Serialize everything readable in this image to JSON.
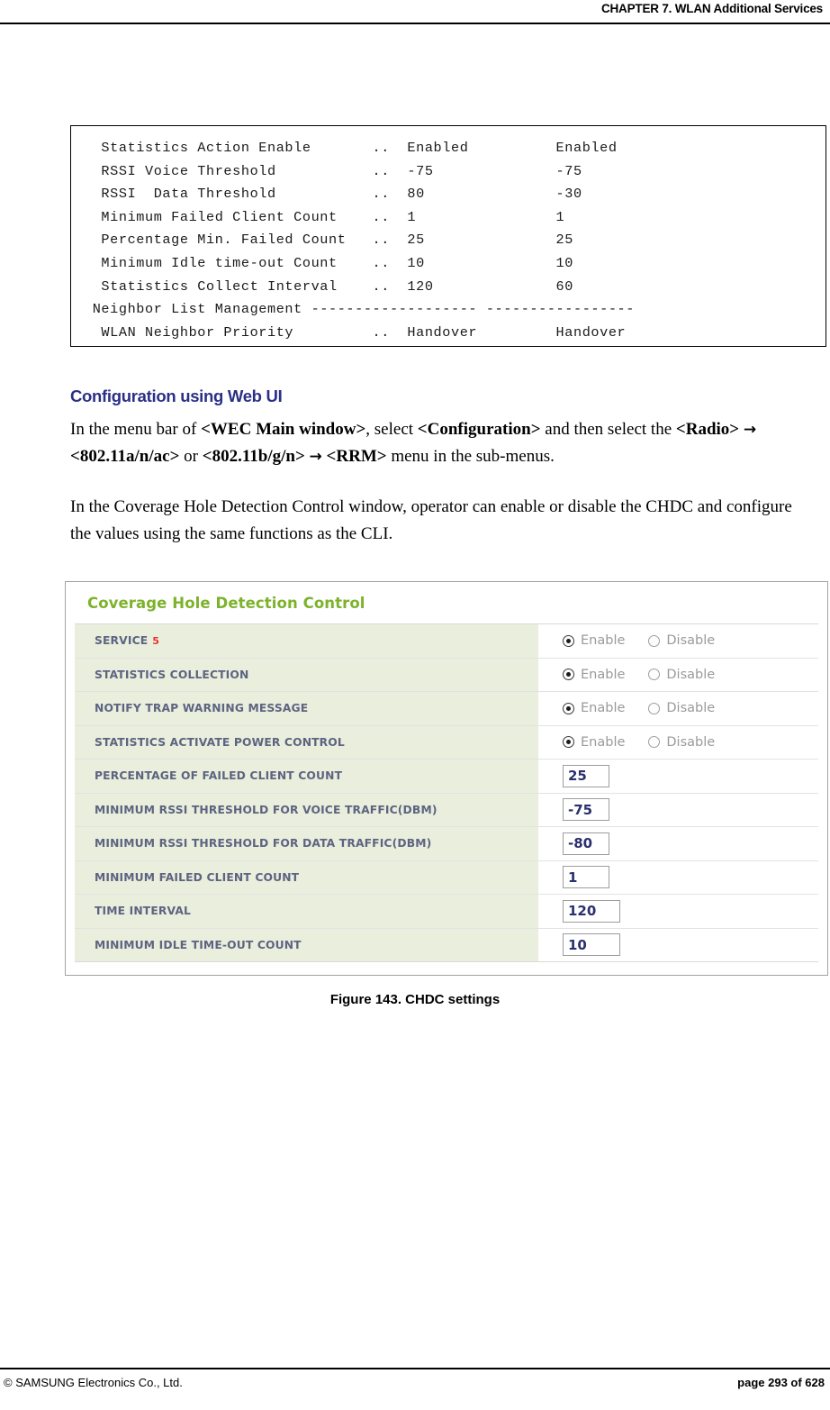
{
  "header": {
    "chapter_title": "CHAPTER 7. WLAN Additional Services"
  },
  "cli_output": {
    "lines": [
      "  Statistics Action Enable       ..  Enabled          Enabled",
      "  RSSI Voice Threshold           ..  -75              -75",
      "  RSSI  Data Threshold           ..  80               -30",
      "  Minimum Failed Client Count    ..  1                1",
      "  Percentage Min. Failed Count   ..  25               25",
      "  Minimum Idle time-out Count    ..  10               10",
      "  Statistics Collect Interval    ..  120              60",
      " Neighbor List Management ------------------- -----------------",
      "  WLAN Neighbor Priority         ..  Handover         Handover"
    ]
  },
  "section": {
    "heading": "Configuration using Web UI",
    "menu_paragraph": {
      "t1": "In the menu bar of ",
      "b1": "<WEC Main window>",
      "t2": ", select ",
      "b2": "<Configuration>",
      "t3": " and then select the ",
      "b3": "<Radio>",
      "arrow1": "→",
      "b4": "<802.11a/n/ac>",
      "t4": " or ",
      "b5": "<802.11b/g/n>",
      "arrow2": "→",
      "b6": "<RRM>",
      "t5": " menu in the sub-menus."
    },
    "chdc_paragraph": "In the Coverage Hole Detection Control window, operator can enable or disable the CHDC and configure the values using the same functions as the CLI."
  },
  "ui_panel": {
    "title": "Coverage Hole Detection Control",
    "radio_labels": {
      "enable": "Enable",
      "disable": "Disable"
    },
    "rows": [
      {
        "label": "SERVICE",
        "note": "5",
        "type": "radio",
        "selected": "enable"
      },
      {
        "label": "STATISTICS COLLECTION",
        "note": "",
        "type": "radio",
        "selected": "enable"
      },
      {
        "label": "NOTIFY TRAP WARNING MESSAGE",
        "note": "",
        "type": "radio",
        "selected": "enable"
      },
      {
        "label": "STATISTICS ACTIVATE POWER CONTROL",
        "note": "",
        "type": "radio",
        "selected": "enable"
      },
      {
        "label": "PERCENTAGE OF FAILED CLIENT COUNT",
        "note": "",
        "type": "input",
        "value": "25",
        "width": "narrow"
      },
      {
        "label": "MINIMUM RSSI THRESHOLD FOR VOICE TRAFFIC(DBM)",
        "note": "",
        "type": "input",
        "value": "-75",
        "width": "narrow"
      },
      {
        "label": "MINIMUM RSSI THRESHOLD FOR DATA TRAFFIC(DBM)",
        "note": "",
        "type": "input",
        "value": "-80",
        "width": "narrow"
      },
      {
        "label": "MINIMUM FAILED CLIENT COUNT",
        "note": "",
        "type": "input",
        "value": "1",
        "width": "narrow"
      },
      {
        "label": "TIME INTERVAL",
        "note": "",
        "type": "input",
        "value": "120",
        "width": "wide"
      },
      {
        "label": "MINIMUM IDLE TIME-OUT COUNT",
        "note": "",
        "type": "input",
        "value": "10",
        "width": "wide"
      }
    ]
  },
  "figure": {
    "caption": "Figure 143. CHDC settings"
  },
  "footer": {
    "copyright": "© SAMSUNG Electronics Co., Ltd.",
    "page_number": "page 293 of 628"
  },
  "colors": {
    "heading_blue": "#2b2f85",
    "panel_title_green": "#7db22b",
    "label_bg": "#eaeedd",
    "label_text": "#5d6480",
    "note_red": "#e8332a",
    "input_text": "#2a2f6e"
  }
}
